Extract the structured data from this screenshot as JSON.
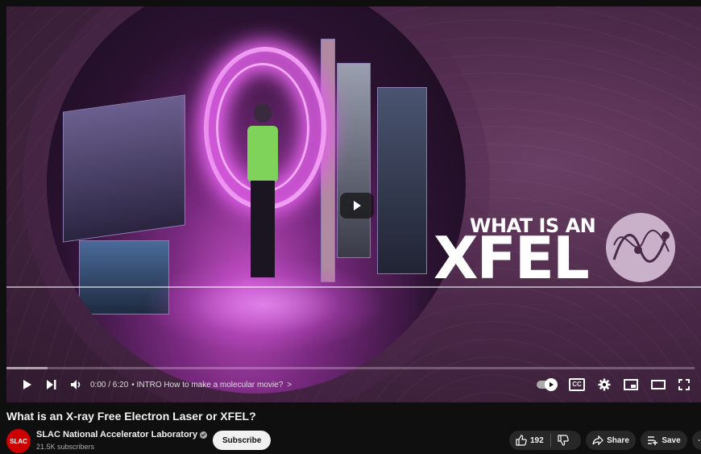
{
  "video": {
    "thumbnail_headline_top": "WHAT IS AN",
    "thumbnail_headline_main": "XFEL",
    "time_display": "0:00 / 6:20",
    "chapter": "• INTRO How to make a molecular movie?",
    "chapter_chevron": ">",
    "cc_label": "CC",
    "progress_played_fraction": 0.0,
    "progress_loaded_fraction": 0.06
  },
  "info": {
    "title": "What is an X-ray Free Electron Laser or XFEL?",
    "channel_name": "SLAC National Accelerator Laboratory",
    "avatar_text": "SLAC",
    "subscribers": "21.5K subscribers",
    "subscribe_label": "Subscribe",
    "like_count": "192",
    "share_label": "Share",
    "save_label": "Save",
    "more_label": "⋯"
  },
  "colors": {
    "accent": "#ff0000",
    "background": "#0f0f0f",
    "pill": "#272727",
    "avatar": "#cc0000"
  },
  "icons": [
    "play-icon",
    "next-icon",
    "volume-icon",
    "autoplay-toggle-icon",
    "cc-icon",
    "settings-gear-icon",
    "miniplayer-icon",
    "theater-mode-icon",
    "fullscreen-icon",
    "like-icon",
    "dislike-icon",
    "share-icon",
    "save-playlist-icon",
    "more-icon",
    "verified-icon"
  ]
}
